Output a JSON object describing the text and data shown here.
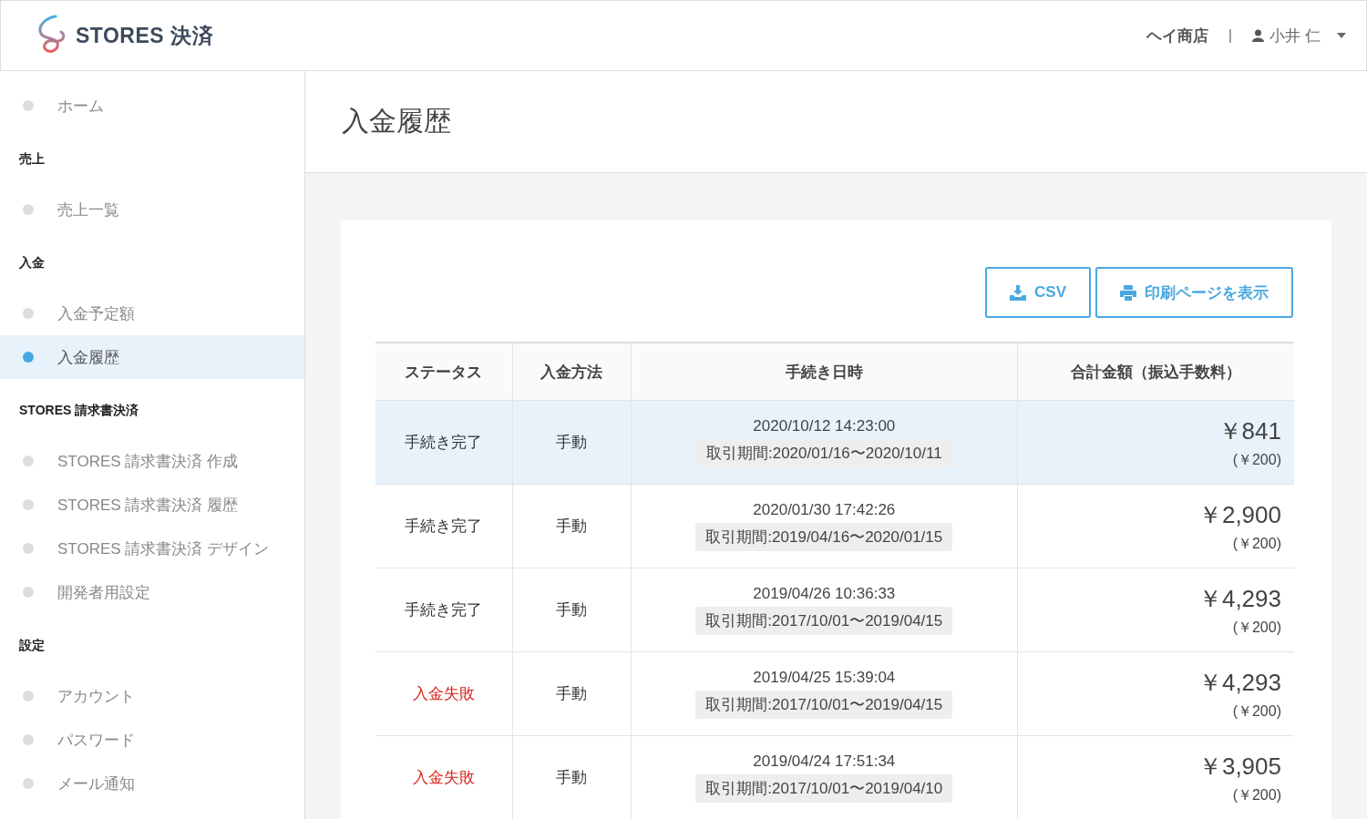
{
  "header": {
    "logo_text": "STORES 決済",
    "shop": "ヘイ商店",
    "separator": "|",
    "user": "小井 仁"
  },
  "sidebar": {
    "groups": [
      {
        "items": [
          {
            "label": "ホーム",
            "selected": false
          }
        ]
      },
      {
        "heading": "売上",
        "items": [
          {
            "label": "売上一覧",
            "selected": false
          }
        ]
      },
      {
        "heading": "入金",
        "items": [
          {
            "label": "入金予定額",
            "selected": false
          },
          {
            "label": "入金履歴",
            "selected": true
          }
        ]
      },
      {
        "heading": "STORES 請求書決済",
        "items": [
          {
            "label": "STORES 請求書決済 作成",
            "selected": false
          },
          {
            "label": "STORES 請求書決済 履歴",
            "selected": false
          },
          {
            "label": "STORES 請求書決済 デザイン",
            "selected": false
          },
          {
            "label": "開発者用設定",
            "selected": false
          }
        ]
      },
      {
        "heading": "設定",
        "items": [
          {
            "label": "アカウント",
            "selected": false
          },
          {
            "label": "パスワード",
            "selected": false
          },
          {
            "label": "メール通知",
            "selected": false
          }
        ]
      }
    ]
  },
  "page_title": "入金履歴",
  "buttons": [
    {
      "kind": "download",
      "label": "CSV"
    },
    {
      "kind": "print",
      "label": "印刷ページを表示"
    }
  ],
  "table": {
    "columns": [
      "ステータス",
      "入金方法",
      "手続き日時",
      "合計金額（振込手数料）"
    ],
    "rows": [
      {
        "selected": true,
        "status": "手続き完了",
        "kind": "done",
        "method": "手動",
        "datetime": "2020/10/12 14:23:00",
        "period": "取引期間:2020/01/16〜2020/10/11",
        "amount": "￥841",
        "fee": "(￥200)"
      },
      {
        "selected": false,
        "status": "手続き完了",
        "kind": "done",
        "method": "手動",
        "datetime": "2020/01/30 17:42:26",
        "period": "取引期間:2019/04/16〜2020/01/15",
        "amount": "￥2,900",
        "fee": "(￥200)"
      },
      {
        "selected": false,
        "status": "手続き完了",
        "kind": "done",
        "method": "手動",
        "datetime": "2019/04/26 10:36:33",
        "period": "取引期間:2017/10/01〜2019/04/15",
        "amount": "￥4,293",
        "fee": "(￥200)"
      },
      {
        "selected": false,
        "status": "入金失敗",
        "kind": "failed",
        "method": "手動",
        "datetime": "2019/04/25 15:39:04",
        "period": "取引期間:2017/10/01〜2019/04/15",
        "amount": "￥4,293",
        "fee": "(￥200)"
      },
      {
        "selected": false,
        "status": "入金失敗",
        "kind": "failed",
        "method": "手動",
        "datetime": "2019/04/24 17:51:34",
        "period": "取引期間:2017/10/01〜2019/04/10",
        "amount": "￥3,905",
        "fee": "(￥200)"
      }
    ]
  }
}
